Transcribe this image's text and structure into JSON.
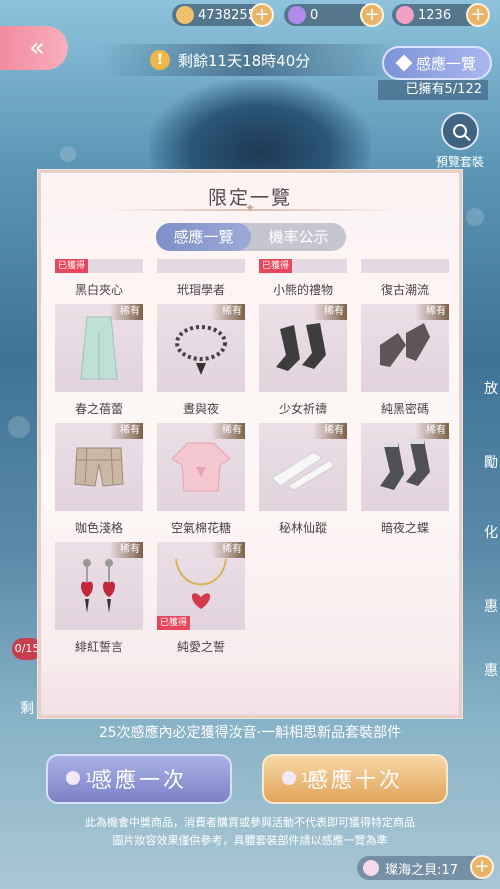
{
  "resources": [
    {
      "icon": "cat-coin-icon",
      "value": "4738255"
    },
    {
      "icon": "purple-gem-icon",
      "value": "0"
    },
    {
      "icon": "pink-diamond-icon",
      "value": "1236"
    }
  ],
  "header": {
    "back_label": "«",
    "timer_icon": "!",
    "timer_text": "剩餘11天18時40分",
    "ganying_button": "感應一覽",
    "owned_text": "已擁有5/122",
    "preview_label": "預覽套裝"
  },
  "side_labels": [
    "放",
    "勵",
    "化",
    "惠",
    "惠"
  ],
  "side_badge": "0/15",
  "side_rem": "剩",
  "panel": {
    "title": "限定一覽",
    "tabs": [
      {
        "label": "感應一覽",
        "active": true
      },
      {
        "label": "機率公示",
        "active": false
      }
    ],
    "top_row": [
      {
        "got": "已獲得",
        "name": "黑白夾心"
      },
      {
        "got": "",
        "name": "玳瑁學者"
      },
      {
        "got": "已獲得",
        "name": "小熊的禮物"
      },
      {
        "got": "",
        "name": "復古潮流"
      }
    ],
    "rare_label": "稀有",
    "got_label": "已獲得",
    "rows": [
      {
        "items": [
          {
            "icon": "skirt-icon",
            "color": "#bfe0d6",
            "rare": true,
            "got": false
          },
          {
            "icon": "pearl-necklace-icon",
            "color": "#444444",
            "rare": true,
            "got": false
          },
          {
            "icon": "black-socks-icon",
            "color": "#3d3d3d",
            "rare": true,
            "got": false
          },
          {
            "icon": "grey-socks-icon",
            "color": "#5e5558",
            "rare": true,
            "got": false
          }
        ],
        "names": [
          "春之蓓蕾",
          "晝與夜",
          "少女祈禱",
          "純黑密碼"
        ]
      },
      {
        "items": [
          {
            "icon": "plaid-shorts-icon",
            "color": "#cbb8a4",
            "rare": true,
            "got": false
          },
          {
            "icon": "pink-top-icon",
            "color": "#f4c6d0",
            "rare": true,
            "got": false
          },
          {
            "icon": "white-sleeve-icon",
            "color": "#f4f4f4",
            "rare": true,
            "got": false
          },
          {
            "icon": "lace-socks-icon",
            "color": "#505055",
            "rare": true,
            "got": false
          }
        ],
        "names": [
          "咖色淺格",
          "空氣棉花糖",
          "秘林仙蹤",
          "暗夜之蝶"
        ]
      },
      {
        "items": [
          {
            "icon": "red-earrings-icon",
            "color": "#c0283a",
            "rare": true,
            "got": false
          },
          {
            "icon": "heart-necklace-icon",
            "color": "#d33a4a",
            "rare": true,
            "got": true
          }
        ],
        "names": [
          "緋紅誓言",
          "純愛之誓"
        ]
      }
    ]
  },
  "footer": {
    "guarantee": "25次感應內必定獲得汝音·一斛相思新品套裝部件",
    "draw_one": {
      "cost": "1",
      "label": "感應一次"
    },
    "draw_ten": {
      "cost": "10",
      "label": "感應十次"
    },
    "disclaimer_1": "此為機會中獎商品，消費者購買或參與活動不代表即可獲得特定商品",
    "disclaimer_2": "圖片妝容效果僅供參考，具體套裝部件請以感應一覽為準",
    "shell_label": "璨海之貝:17"
  }
}
